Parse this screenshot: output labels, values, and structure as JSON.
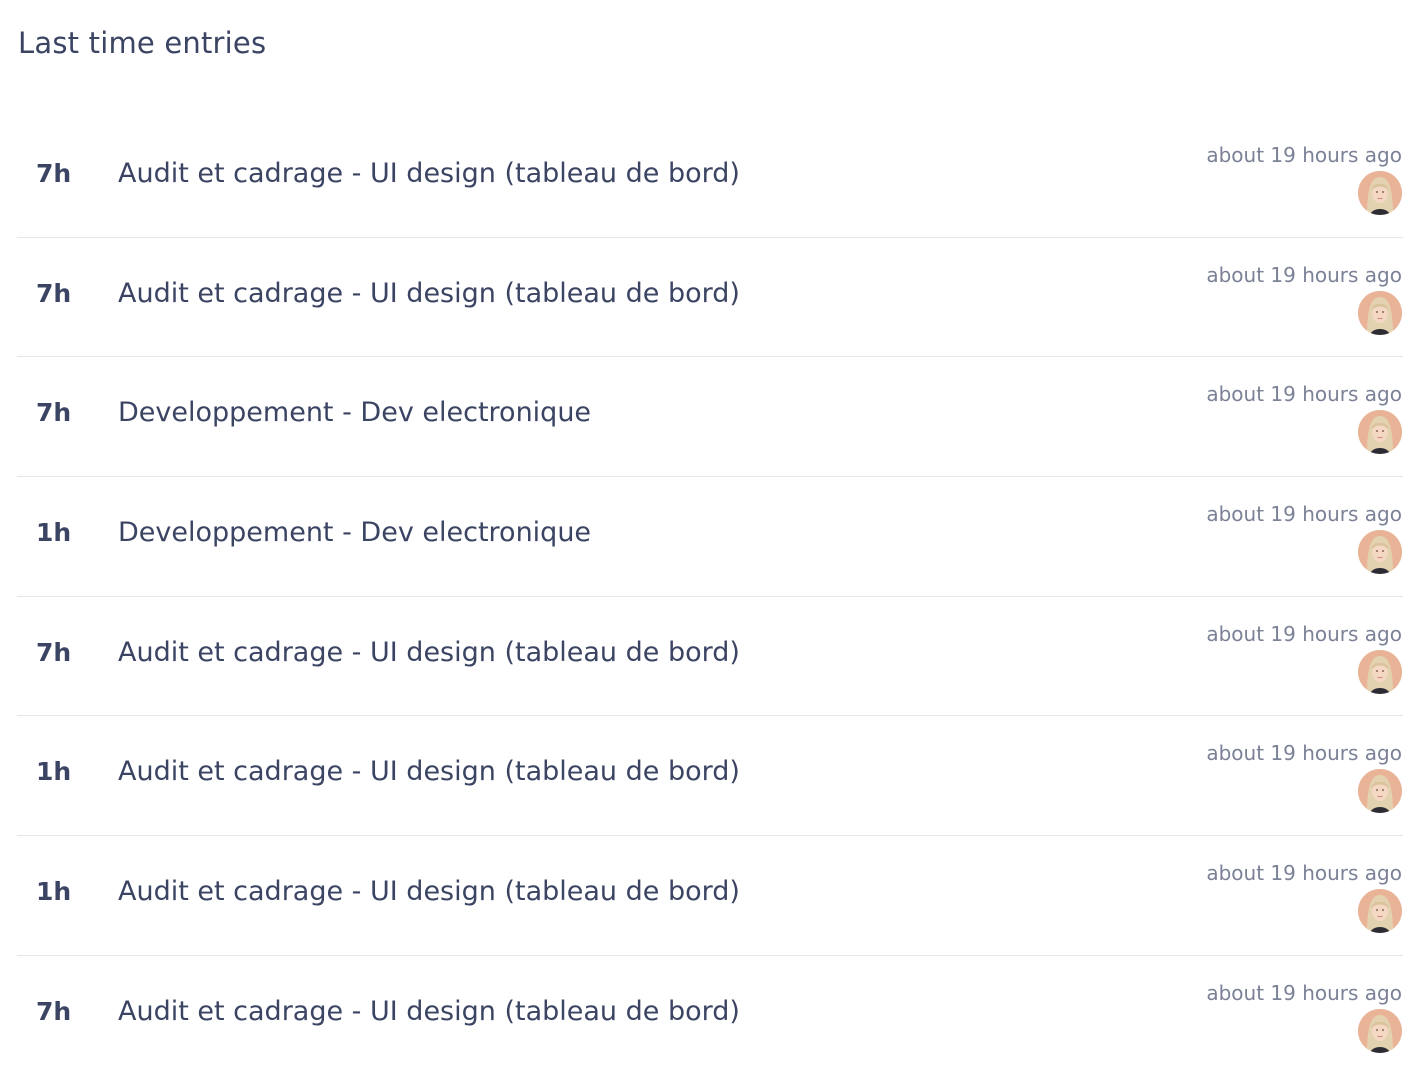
{
  "header": {
    "title": "Last time entries"
  },
  "entries": [
    {
      "hours": "7h",
      "description": "Audit et cadrage - UI design (tableau de bord)",
      "time": "about 19 hours ago"
    },
    {
      "hours": "7h",
      "description": "Audit et cadrage - UI design (tableau de bord)",
      "time": "about 19 hours ago"
    },
    {
      "hours": "7h",
      "description": "Developpement - Dev electronique",
      "time": "about 19 hours ago"
    },
    {
      "hours": "1h",
      "description": "Developpement - Dev electronique",
      "time": "about 19 hours ago"
    },
    {
      "hours": "7h",
      "description": "Audit et cadrage - UI design (tableau de bord)",
      "time": "about 19 hours ago"
    },
    {
      "hours": "1h",
      "description": "Audit et cadrage - UI design (tableau de bord)",
      "time": "about 19 hours ago"
    },
    {
      "hours": "1h",
      "description": "Audit et cadrage - UI design (tableau de bord)",
      "time": "about 19 hours ago"
    },
    {
      "hours": "7h",
      "description": "Audit et cadrage - UI design (tableau de bord)",
      "time": "about 19 hours ago"
    }
  ],
  "colors": {
    "text": "#3b4463",
    "muted": "#7b8196",
    "divider": "#e4e6ea",
    "avatar_bg": "#e9b397"
  }
}
